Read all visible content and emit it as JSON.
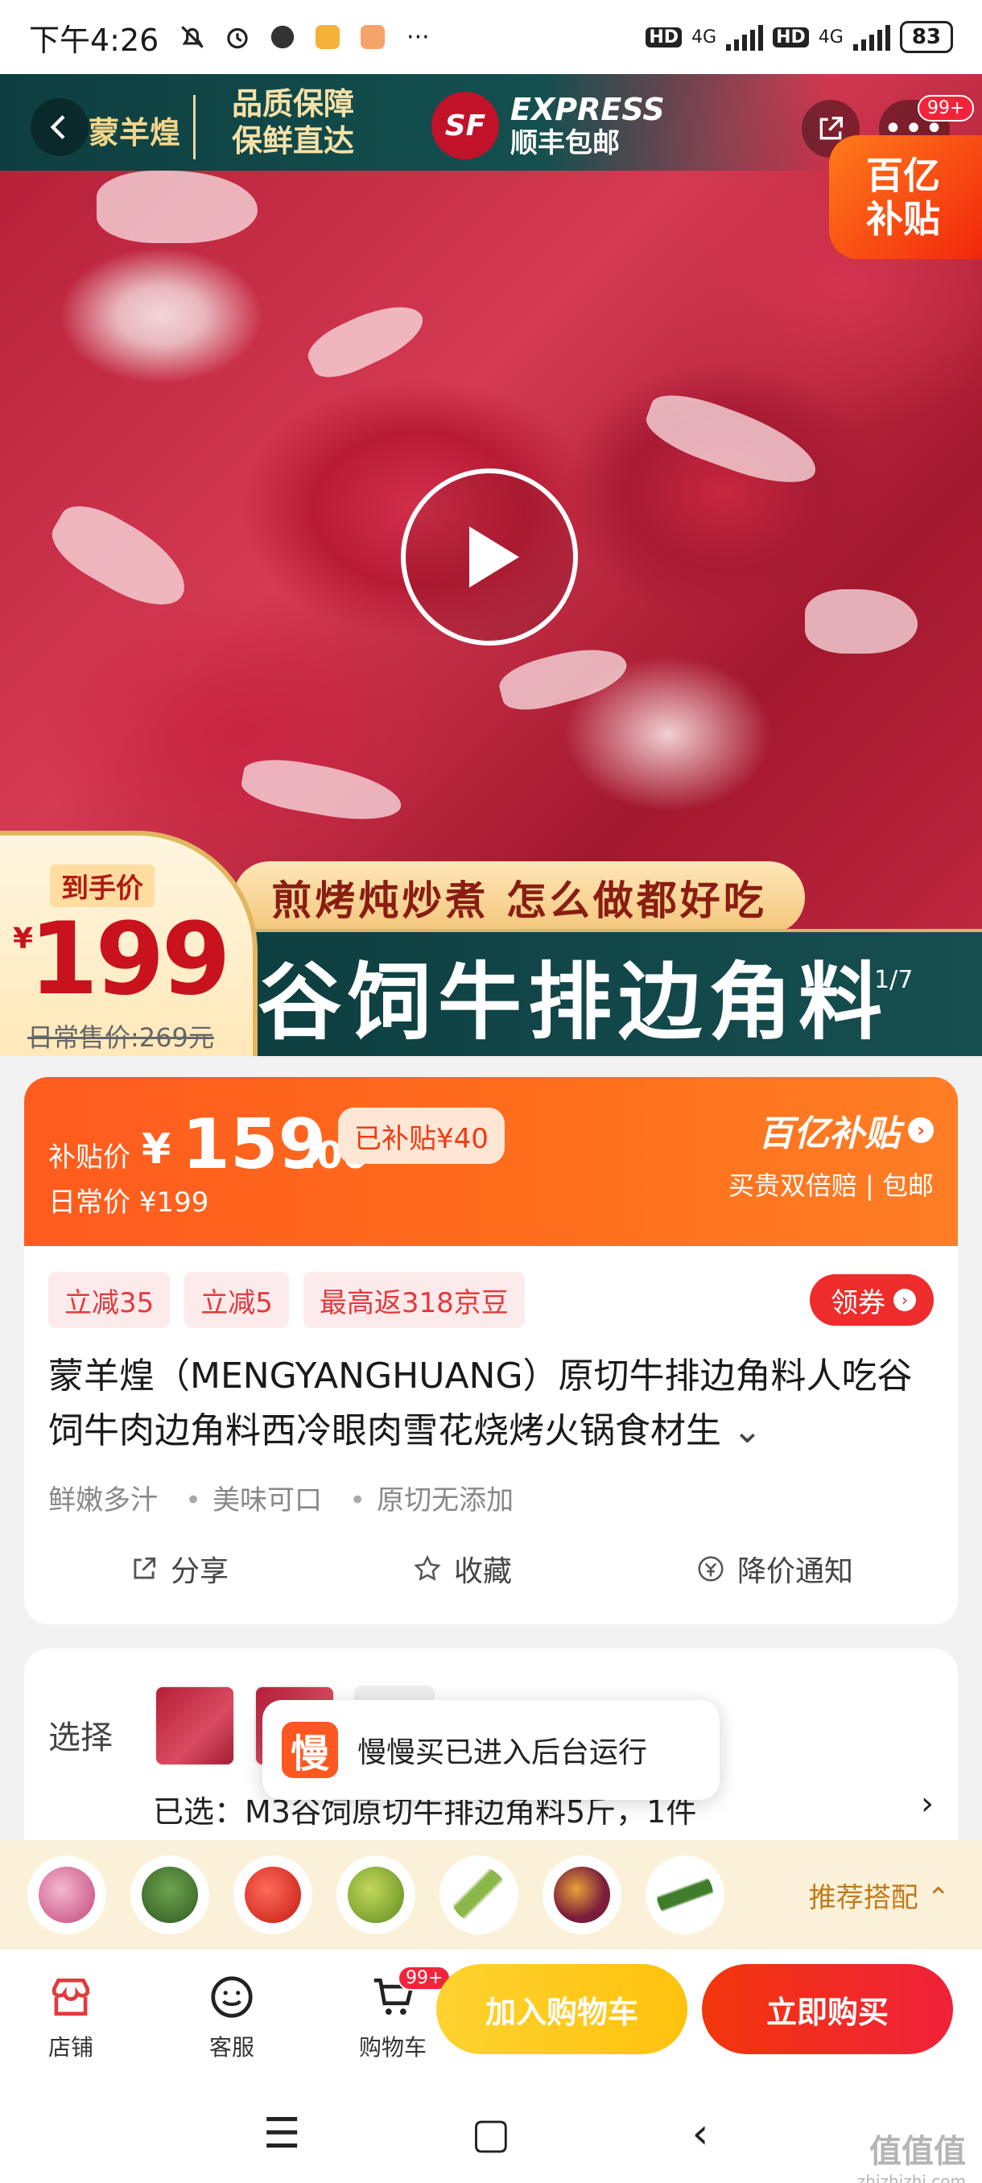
{
  "status_bar": {
    "time": "下午4:26",
    "network_1": "HD",
    "network_2": "4G",
    "network_3": "HD",
    "network_4": "4G",
    "battery": "83",
    "more": "···"
  },
  "hero": {
    "brand": "蒙羊煌",
    "slogan_line1": "品质保障",
    "slogan_line2": "保鲜直达",
    "sf_logo": "SF",
    "sf_line1": "EXPRESS",
    "sf_line2": "顺丰包邮",
    "message_badge": "99+",
    "subsidy_line1": "百亿",
    "subsidy_line2": "补贴",
    "cook_slogan": "煎烤炖炒煮 怎么做都好吃",
    "product_banner": "谷饲牛排边角料",
    "price_label": "到手价",
    "price_yen": "¥",
    "price_value": "199",
    "regular_price": "日常售价:269元",
    "page_indicator": "1/7"
  },
  "price_card": {
    "subsidy_label": "补贴价",
    "yen": "¥",
    "price_int": "159",
    "price_dec": ".00",
    "subsidized_amount": "已补贴¥40",
    "regular_price": "日常价 ¥199",
    "brand_title": "百亿补贴",
    "brand_chevron": "›",
    "brand_subtitle": "买贵双倍赔 | 包邮",
    "promos": [
      "立减35",
      "立减5",
      "最高返318京豆"
    ],
    "coupon_label": "领券",
    "coupon_arrow": "›",
    "title": "蒙羊煌（MENGYANGHUANG）原切牛排边角料人吃谷饲牛肉边角料西冷眼肉雪花烧烤火锅食材生",
    "title_expand": "⌄",
    "features": [
      "鲜嫩多汁",
      "美味可口",
      "原切无添加"
    ],
    "action_share": "分享",
    "action_favorite": "收藏",
    "action_price_alert": "降价通知"
  },
  "selection": {
    "label": "选择",
    "selected_text": "已选：M3谷饲原切牛排边角料5斤，1件",
    "chevron": "›"
  },
  "toast": {
    "icon_char": "慢",
    "text": "慢慢买已进入后台运行"
  },
  "recommend": {
    "label": "推荐搭配 ⌃",
    "items": [
      "onion",
      "broccoli",
      "tomato",
      "lime",
      "asparagus",
      "passion-fruit",
      "cucumber"
    ]
  },
  "bottom_bar": {
    "store": "店铺",
    "service": "客服",
    "cart": "购物车",
    "cart_badge": "99+",
    "add_to_cart": "加入购物车",
    "buy_now": "立即购买"
  },
  "nav": {
    "menu": "☰",
    "home": "▢",
    "back": "‹"
  },
  "watermark": {
    "main": "值值值",
    "sub": "zhizhizhi.com"
  },
  "colors": {
    "accent_orange": "#ff5b1e",
    "buy_red": "#f0213a",
    "cart_yellow": "#ffc20e",
    "promo_red": "#e4393c"
  }
}
